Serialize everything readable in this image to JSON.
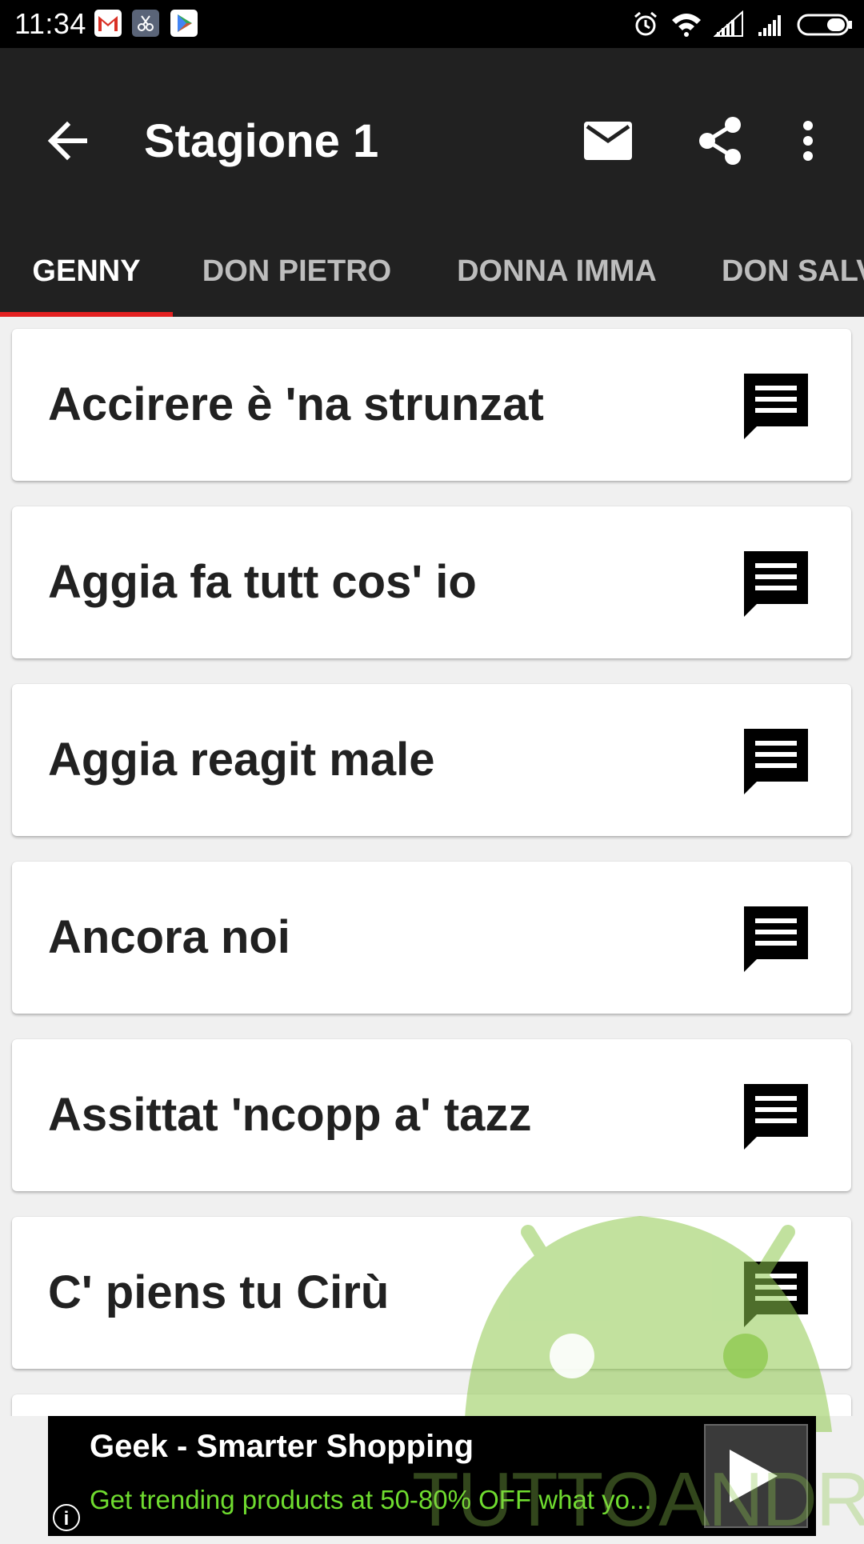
{
  "status_bar": {
    "time": "11:34",
    "notifications": [
      "gmail-icon",
      "scissors-icon",
      "play-store-icon"
    ],
    "indicators": [
      "alarm-icon",
      "wifi-icon",
      "signal-icon",
      "signal-icon",
      "battery-icon"
    ]
  },
  "toolbar": {
    "title": "Stagione 1",
    "actions": [
      "back-arrow-icon",
      "mail-icon",
      "share-icon",
      "more-vert-icon"
    ]
  },
  "tabs": [
    {
      "label": "GENNY",
      "active": true
    },
    {
      "label": "DON PIETRO",
      "active": false
    },
    {
      "label": "DONNA IMMA",
      "active": false
    },
    {
      "label": "DON SALV",
      "active": false
    }
  ],
  "items": [
    {
      "label": "Accirere è 'na strunzat"
    },
    {
      "label": "Aggia fa tutt cos' io"
    },
    {
      "label": "Aggia reagit male"
    },
    {
      "label": "Ancora noi"
    },
    {
      "label": "Assittat 'ncopp a' tazz"
    },
    {
      "label": "C' piens tu Cirù"
    }
  ],
  "ad": {
    "title": "Geek - Smarter Shopping",
    "description": "Get trending products at 50-80% OFF what yo...",
    "info": "i"
  },
  "watermark": {
    "text": "TUTTOANDROID"
  },
  "colors": {
    "appbar": "#212121",
    "tab_indicator": "#e32020",
    "ad_text": "#6fdc2f",
    "watermark": "#8fc94f"
  }
}
